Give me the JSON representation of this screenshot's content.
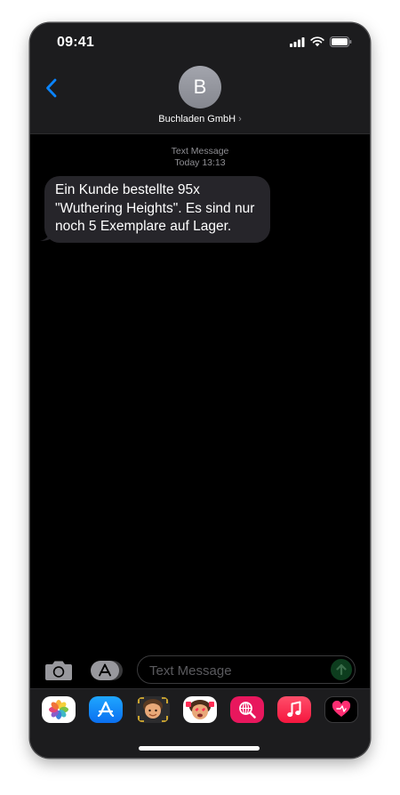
{
  "status_bar": {
    "time": "09:41"
  },
  "header": {
    "avatar_initial": "B",
    "contact_name": "Buchladen GmbH",
    "contact_chevron": "›"
  },
  "conversation": {
    "service_label": "Text Message",
    "timestamp": "Today 13:13",
    "messages": [
      {
        "direction": "incoming",
        "text": "Ein Kunde bestellte 95x \"Wuthering Heights\". Es sind nur noch 5 Exemplare auf Lager."
      }
    ]
  },
  "input_bar": {
    "placeholder": "Text Message"
  },
  "app_drawer": {
    "apps": [
      {
        "name": "photos-app-icon"
      },
      {
        "name": "app-store-app-icon"
      },
      {
        "name": "memoji-app-icon"
      },
      {
        "name": "memoji-stickers-app-icon"
      },
      {
        "name": "web-search-app-icon"
      },
      {
        "name": "music-app-icon"
      },
      {
        "name": "digital-touch-app-icon"
      }
    ]
  },
  "colors": {
    "accent": "#0a84ff",
    "incoming_bubble": "#26252a",
    "header_background": "#1c1c1e",
    "send_button": "#0d3d1e"
  }
}
